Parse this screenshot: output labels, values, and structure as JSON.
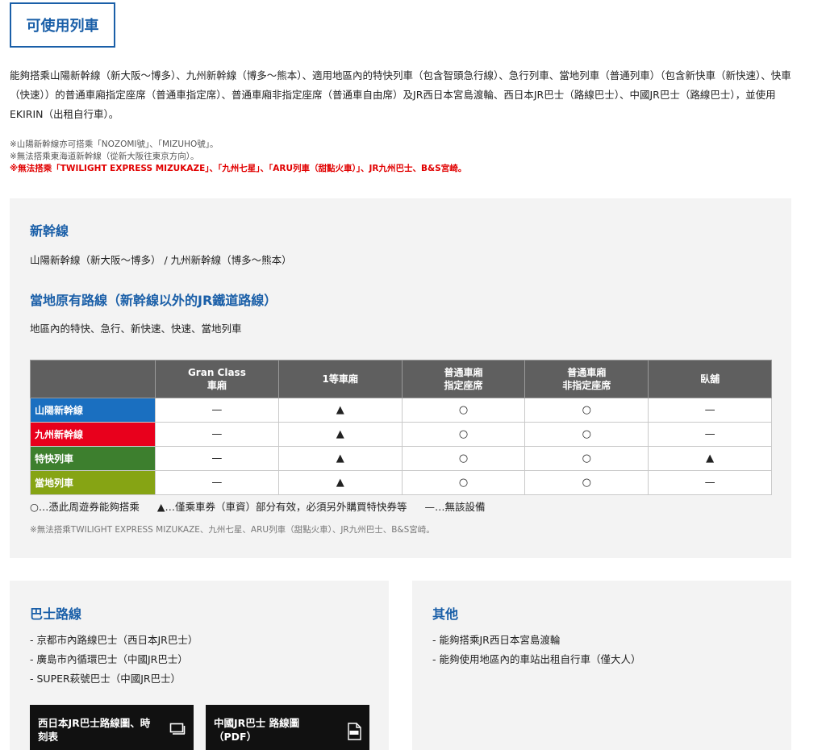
{
  "page_title": "可使用列車",
  "intro": "能夠搭乘山陽新幹線（新大阪～博多）、九州新幹線（博多～熊本）、適用地區內的特快列車（包含智頭急行線）、急行列車、當地列車（普通列車）（包含新快車（新快速）、快車（快速））的普通車廂指定座席（普通車指定席）、普通車廂非指定座席（普通車自由席）及JR西日本宮島渡輪、西日本JR巴士（路線巴士）、中國JR巴士（路線巴士），並使用EKIRIN（出租自行車）。",
  "notes": [
    "※山陽新幹線亦可搭乘「NOZOMI號」、「MIZUHO號」。",
    "※無法搭乘東海道新幹線（從新大阪往東京方向）。",
    "※無法搭乘「TWILIGHT EXPRESS MIZUKAZE」、「九州七星」、「ARU列車（甜點火車）」、JR九州巴士、B&S宮崎。"
  ],
  "shinkansen": {
    "heading": "新幹線",
    "text": "山陽新幹線（新大阪～博多） / 九州新幹線（博多～熊本）"
  },
  "conventional": {
    "heading": "當地原有路線（新幹線以外的JR鐵道路線）",
    "text": "地區內的特快、急行、新快速、快速、當地列車"
  },
  "table": {
    "headers": [
      "",
      "Gran Class\n車廂",
      "1等車廂",
      "普通車廂\n指定座席",
      "普通車廂\n非指定座席",
      "臥舖"
    ],
    "rows": [
      {
        "label": "山陽新幹線",
        "color": "#1a6fc0",
        "cells": [
          "—",
          "▲",
          "○",
          "○",
          "—"
        ]
      },
      {
        "label": "九州新幹線",
        "color": "#e8001c",
        "cells": [
          "—",
          "▲",
          "○",
          "○",
          "—"
        ]
      },
      {
        "label": "特快列車",
        "color": "#3d7f2e",
        "cells": [
          "—",
          "▲",
          "○",
          "○",
          "▲"
        ]
      },
      {
        "label": "當地列車",
        "color": "#86a414",
        "cells": [
          "—",
          "▲",
          "○",
          "○",
          "—"
        ]
      }
    ]
  },
  "legend": {
    "circle": "○…憑此周遊券能夠搭乘",
    "triangle": "▲…僅乘車券（車資）部分有效，必須另外購買特快券等",
    "dash": "—…無該設備"
  },
  "table_footnote": "※無法搭乘TWILIGHT EXPRESS MIZUKAZE、九州七星、ARU列車（甜點火車）、JR九州巴士、B&S宮崎。",
  "bus": {
    "heading": "巴士路線",
    "items": [
      "- 京都市內路線巴士（西日本JR巴士）",
      "- 廣島市內循環巴士（中國JR巴士）",
      "- SUPER萩號巴士（中國JR巴士）"
    ],
    "buttons": [
      {
        "label": "西日本JR巴士路線圖、時刻表",
        "icon": "window-icon"
      },
      {
        "label": "中國JR巴士 路線圖（PDF）",
        "icon": "pdf-icon"
      }
    ]
  },
  "other": {
    "heading": "其他",
    "items": [
      "- 能夠搭乘JR西日本宮島渡輪",
      "- 能夠使用地區內的車站出租自行車（僅大人）"
    ]
  }
}
